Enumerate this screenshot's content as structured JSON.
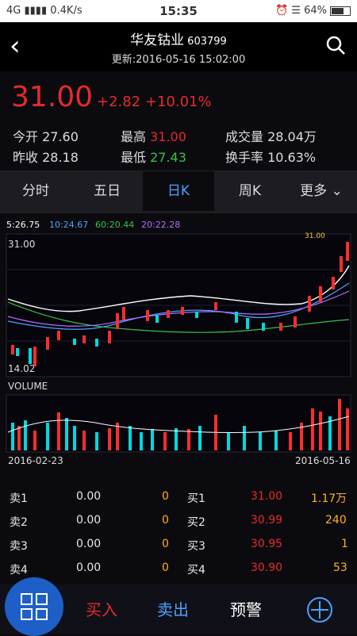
{
  "status": {
    "network": "4G",
    "speed": "0.4K/s",
    "time": "15:35",
    "battery": "64%"
  },
  "header": {
    "name": "华友钴业",
    "code": "603799",
    "updated": "更新:2016-05-16 15:02:00"
  },
  "quote": {
    "price": "31.00",
    "change": "+2.82 +10.01%",
    "open_label": "今开",
    "open": "27.60",
    "prev_label": "昨收",
    "prev": "28.18",
    "high_label": "最高",
    "high": "31.00",
    "low_label": "最低",
    "low": "27.43",
    "vol_label": "成交量",
    "vol": "28.04万",
    "turnover_label": "换手率",
    "turnover": "10.63%"
  },
  "tabs": [
    "分时",
    "五日",
    "日K",
    "周K",
    "更多"
  ],
  "ma": {
    "ma5": "5:26.75",
    "ma10": "10:24.67",
    "ma60": "60:20.44",
    "ma20": "20:22.28"
  },
  "chart_data": {
    "type": "candlestick",
    "price_high_label": "31.00",
    "price_low_label": "14.02",
    "top_label": "31.00",
    "volume_label": "VOLUME",
    "start_date": "2016-02-23",
    "end_date": "2016-05-16",
    "ylim": [
      14.02,
      31.0
    ]
  },
  "orders": {
    "sell": [
      {
        "label": "卖1",
        "price": "0.00",
        "vol": "0"
      },
      {
        "label": "卖2",
        "price": "0.00",
        "vol": "0"
      },
      {
        "label": "卖3",
        "price": "0.00",
        "vol": "0"
      },
      {
        "label": "卖4",
        "price": "0.00",
        "vol": "0"
      }
    ],
    "buy": [
      {
        "label": "买1",
        "price": "31.00",
        "vol": "1.17万"
      },
      {
        "label": "买2",
        "price": "30.99",
        "vol": "240"
      },
      {
        "label": "买3",
        "price": "30.95",
        "vol": "1"
      },
      {
        "label": "买4",
        "price": "30.90",
        "vol": "53"
      }
    ]
  },
  "bottom": {
    "buy": "买入",
    "sell": "卖出",
    "alert": "预警"
  }
}
